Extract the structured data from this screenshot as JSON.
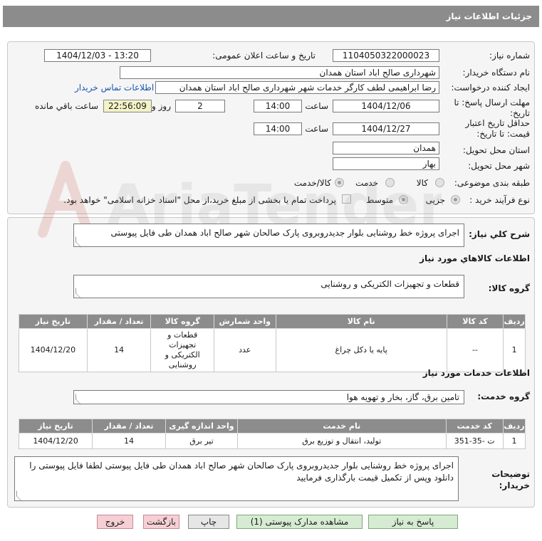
{
  "header": {
    "title": "جزئیات اطلاعات نیاز"
  },
  "labels": {
    "need_number": "شماره نیاز:",
    "announce_datetime": "تاریخ و ساعت اعلان عمومی:",
    "buyer_org": "نام دستگاه خریدار:",
    "requester": "ایجاد کننده درخواست:",
    "reply_deadline": "مهلت ارسال پاسخ: تا تاریخ:",
    "price_validity": "حداقل تاریخ اعتبار قیمت: تا تاریخ:",
    "time": "ساعت",
    "day_and": "روز و",
    "remaining": "ساعت باقي مانده",
    "province": "استان محل تحویل:",
    "city": "شهر محل تحویل:",
    "category": "طبقه بندی موضوعی:",
    "purchase_type": "نوع فرآیند خرید :",
    "need_summary": "شرح كلي نياز:",
    "goods_info": "اطلاعات كالاهاي مورد نياز",
    "goods_group": "گروه كالا:",
    "services_info": "اطلاعات خدمات مورد نياز",
    "service_group": "گروه خدمت:",
    "buyer_notes": "توضیحات خریدار:"
  },
  "values": {
    "need_number": "1104050322000023",
    "announce_datetime": "1404/12/03 - 13:20",
    "buyer_org": "شهرداری صالح اباد استان همدان",
    "requester": "رضا ابراهیمی لطف کارگر خدمات شهر شهرداری صالح اباد استان همدان",
    "contact_link": "اطلاعات تماس خریدار",
    "reply_date": "1404/12/06",
    "reply_time": "14:00",
    "reply_days": "2",
    "remaining_time": "22:56:09",
    "validity_date": "1404/12/27",
    "validity_time": "14:00",
    "province": "همدان",
    "city": "بهار",
    "need_summary": "اجرای پروژه خط روشنایی بلوار جدیدروبروی پارک صالحان شهر صالح اباد همدان طی فایل پیوستی",
    "goods_group": "قطعات و تجهیزات الکتریکی و روشنایی",
    "service_group": "تامین برق، گاز، بخار و تهویه هوا",
    "buyer_notes": "اجرای پروژه خط روشنایی بلوار جدیدروبروی پارک صالحان شهر صالح اباد همدان طی فایل پیوستی لطفا فایل پیوستی را دانلود وپس از تکمیل قیمت بارگذاری فرمایید"
  },
  "category_options": {
    "goods": "كالا",
    "service": "خدمت",
    "goods_service": "كالا/خدمت"
  },
  "purchase_options": {
    "partial": "جزیی",
    "medium": "متوسط",
    "treasury_note": "پرداخت تمام یا بخشی از مبلغ خرید،از محل \"اسناد خزانه اسلامی\" خواهد بود."
  },
  "goods_table": {
    "headers": [
      "ردیف",
      "کد کالا",
      "نام کالا",
      "واحد شمارش",
      "گروه کالا",
      "تعداد / مقدار",
      "تاریخ نیاز"
    ],
    "rows": [
      [
        "1",
        "--",
        "پایه یا دکل چراغ",
        "عدد",
        "قطعات و تجهیزات الکتریکی و روشنایی",
        "14",
        "1404/12/20"
      ]
    ]
  },
  "services_table": {
    "headers": [
      "ردیف",
      "کد خدمت",
      "نام خدمت",
      "واحد اندازه گیری",
      "تعداد / مقدار",
      "تاریخ نیاز"
    ],
    "rows": [
      [
        "1",
        "ت -35-351",
        "تولید، انتقال و توزیع برق",
        "تیر برق",
        "14",
        "1404/12/20"
      ]
    ]
  },
  "buttons": {
    "reply": "پاسخ به نیاز",
    "attachments": "مشاهده مدارک پیوستی (1)",
    "print": "چاپ",
    "back": "بازگشت",
    "exit": "خروج"
  },
  "colors": {
    "header_bg": "#8c8c8c",
    "panel_bg": "#f5f5f5",
    "link": "#1a55b4",
    "remaining_bg": "#f3f3c7"
  },
  "watermark_text": "AriaTender.neT"
}
